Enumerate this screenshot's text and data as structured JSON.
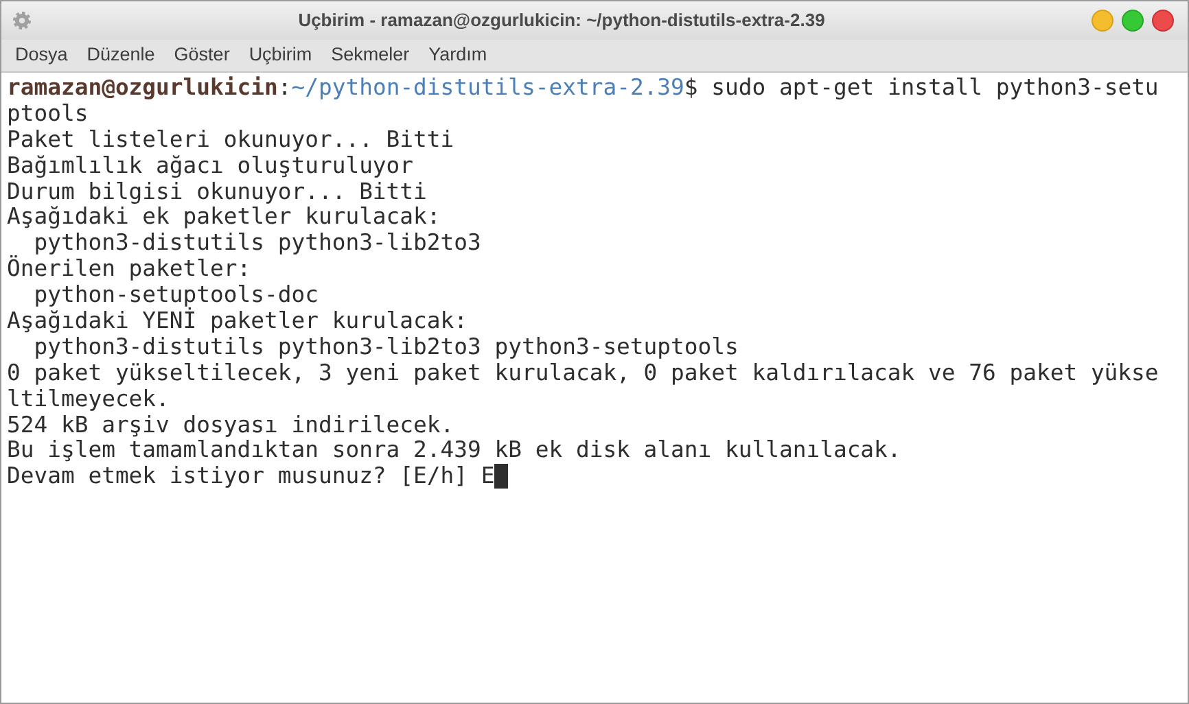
{
  "window": {
    "title": "Uçbirim - ramazan@ozgurlukicin: ~/python-distutils-extra-2.39"
  },
  "menu": [
    "Dosya",
    "Düzenle",
    "Göster",
    "Uçbirim",
    "Sekmeler",
    "Yardım"
  ],
  "terminal": {
    "prompt": {
      "user_host": "ramazan@ozgurlukicin",
      "separator": ":",
      "path": "~/python-distutils-extra-2.39",
      "symbol": "$",
      "command": " sudo apt-get install python3-setu"
    },
    "lines": [
      "ptools",
      "Paket listeleri okunuyor... Bitti",
      "Bağımlılık ağacı oluşturuluyor",
      "Durum bilgisi okunuyor... Bitti",
      "Aşağıdaki ek paketler kurulacak:",
      "  python3-distutils python3-lib2to3",
      "Önerilen paketler:",
      "  python-setuptools-doc",
      "Aşağıdaki YENİ paketler kurulacak:",
      "  python3-distutils python3-lib2to3 python3-setuptools",
      "0 paket yükseltilecek, 3 yeni paket kurulacak, 0 paket kaldırılacak ve 76 paket yükse",
      "ltilmeyecek.",
      "524 kB arşiv dosyası indirilecek.",
      "Bu işlem tamamlandıktan sonra 2.439 kB ek disk alanı kullanılacak."
    ],
    "input_line": {
      "question": "Devam etmek istiyor musunuz? [E/h] ",
      "typed": "E"
    },
    "cursor": true
  }
}
